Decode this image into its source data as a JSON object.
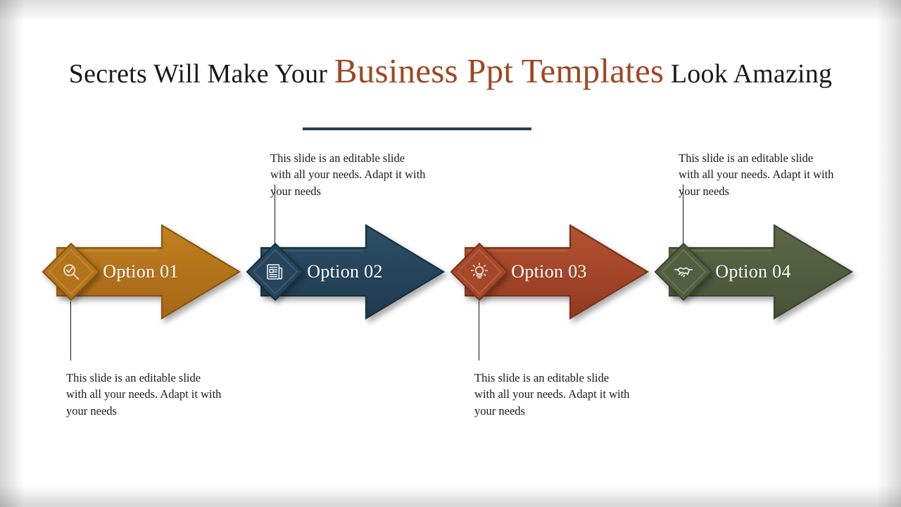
{
  "slide": {
    "background_color": "#ffffff",
    "frame_color": "#d6d6d6"
  },
  "title": {
    "prefix": "Secrets Will Make Your ",
    "accent": "Business Ppt Templates",
    "suffix": " Look Amazing",
    "plain_color": "#1a1a1a",
    "accent_color": "#9E4723",
    "underline_color": "#22414f"
  },
  "caption_text": "This slide is an editable slide with all your needs. Adapt it with your needs",
  "steps": [
    {
      "label": "Option 01",
      "icon": "magnifier-check-icon",
      "color": "#B4741C",
      "color_dark": "#8B5512",
      "color_light": "#C98B2C",
      "caption": "This slide is an editable slide with all your needs. Adapt it with your needs",
      "caption_position": "below"
    },
    {
      "label": "Option 02",
      "icon": "document-news-icon",
      "color": "#26455C",
      "color_dark": "#17303F",
      "color_light": "#37596F",
      "caption": "This slide is an editable slide with all your needs. Adapt it with your needs",
      "caption_position": "above"
    },
    {
      "label": "Option 03",
      "icon": "lightbulb-idea-icon",
      "color": "#A4472A",
      "color_dark": "#7D321B",
      "color_light": "#B65C3C",
      "caption": "This slide is an editable slide with all your needs. Adapt it with your needs",
      "caption_position": "below"
    },
    {
      "label": "Option 04",
      "icon": "handshake-deal-icon",
      "color": "#535E41",
      "color_dark": "#3C4630",
      "color_light": "#667253",
      "caption": "This slide is an editable slide with all your needs. Adapt it with your needs",
      "caption_position": "above"
    }
  ]
}
